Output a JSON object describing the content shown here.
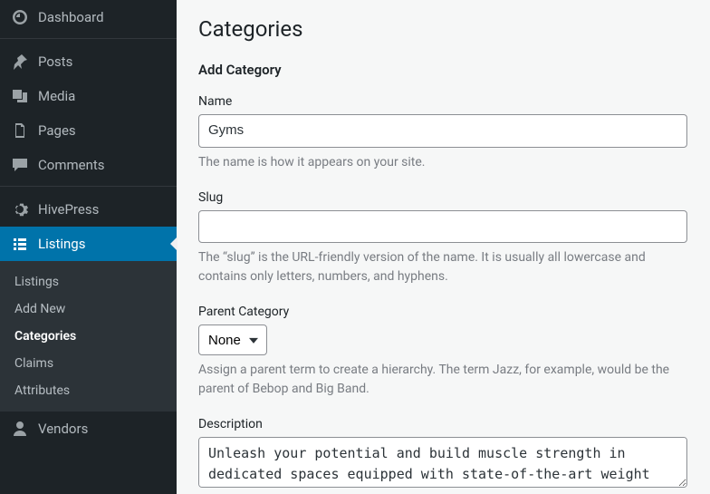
{
  "sidebar": {
    "items": [
      {
        "label": "Dashboard"
      },
      {
        "label": "Posts"
      },
      {
        "label": "Media"
      },
      {
        "label": "Pages"
      },
      {
        "label": "Comments"
      },
      {
        "label": "HivePress"
      },
      {
        "label": "Listings"
      },
      {
        "label": "Vendors"
      }
    ],
    "submenu": [
      {
        "label": "Listings"
      },
      {
        "label": "Add New"
      },
      {
        "label": "Categories"
      },
      {
        "label": "Claims"
      },
      {
        "label": "Attributes"
      }
    ]
  },
  "page": {
    "title": "Categories",
    "section_title": "Add Category"
  },
  "fields": {
    "name": {
      "label": "Name",
      "value": "Gyms",
      "help": "The name is how it appears on your site."
    },
    "slug": {
      "label": "Slug",
      "value": "",
      "help": "The “slug” is the URL-friendly version of the name. It is usually all lowercase and contains only letters, numbers, and hyphens."
    },
    "parent": {
      "label": "Parent Category",
      "selected": "None",
      "help": "Assign a parent term to create a hierarchy. The term Jazz, for example, would be the parent of Bebop and Big Band."
    },
    "description": {
      "label": "Description",
      "value": "Unleash your potential and build muscle strength in dedicated spaces equipped with state-of-the-art weight training equipment."
    }
  }
}
